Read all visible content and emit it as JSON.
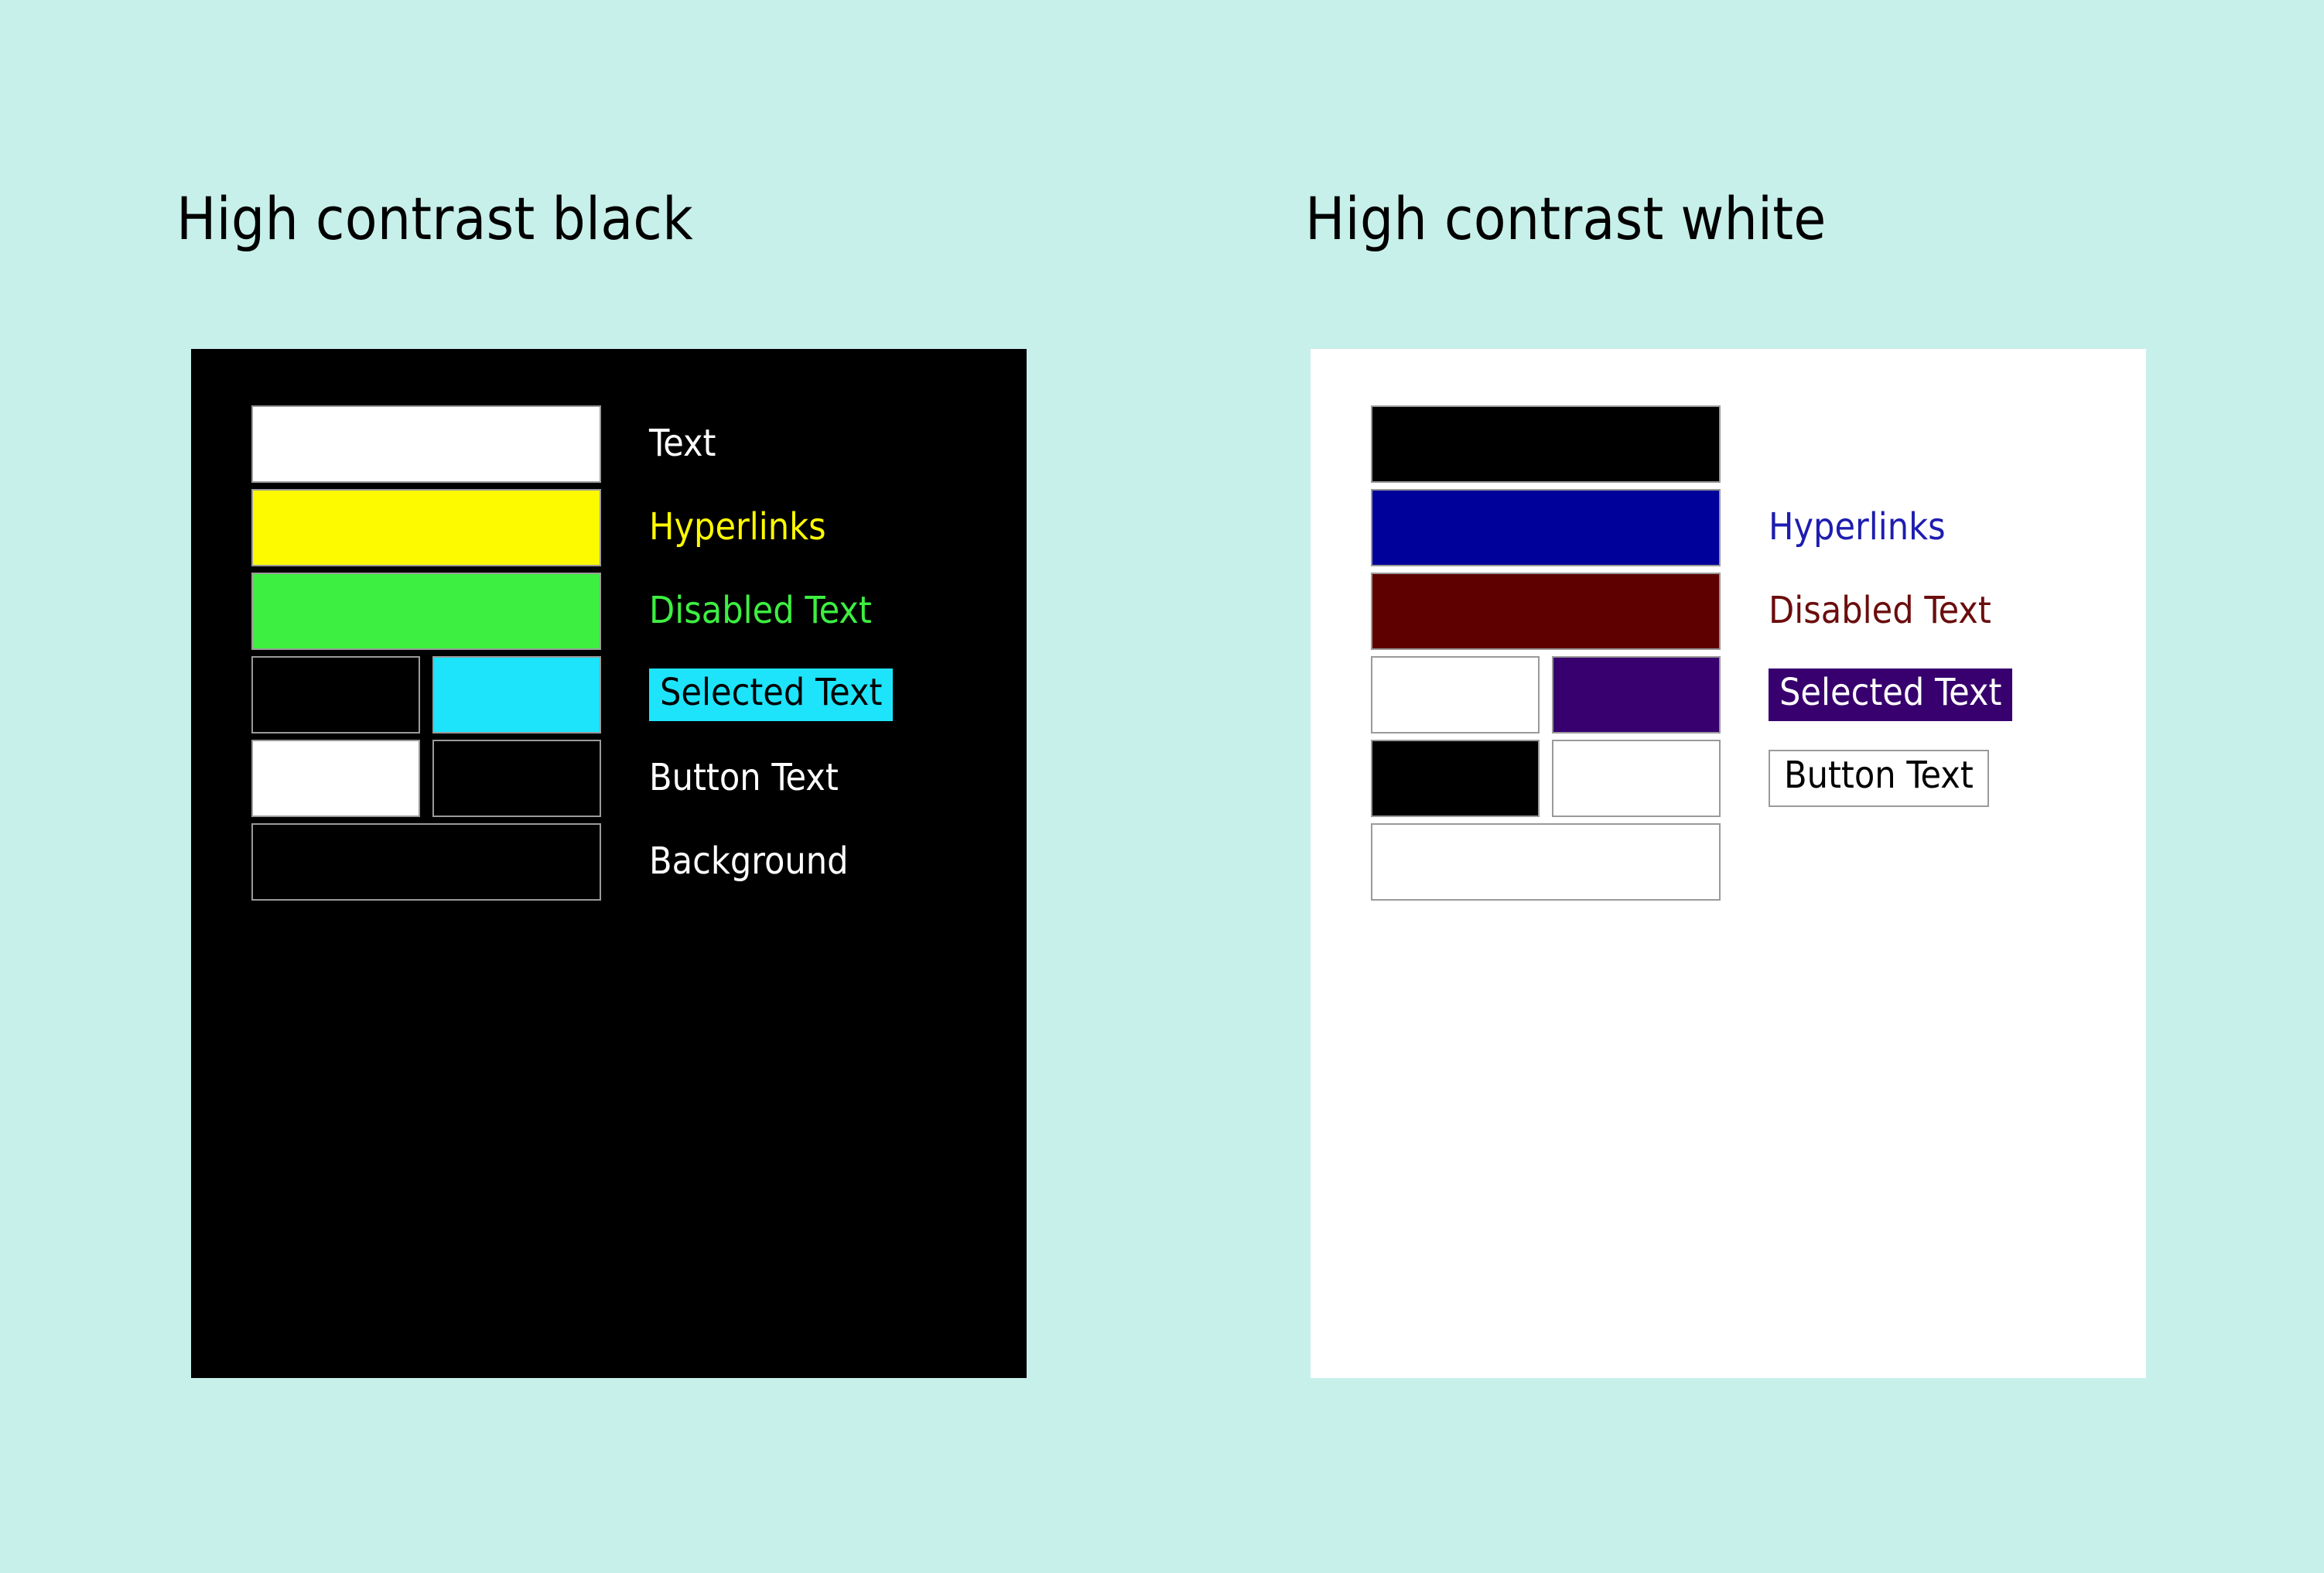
{
  "page": {
    "background_color": "#c8f0ea"
  },
  "themes": [
    {
      "id": "high-contrast-black",
      "title": "High contrast black",
      "panel_background": "#000000",
      "swatch_border_color": "#9a9a9a",
      "rows": [
        {
          "name": "text",
          "swatches": [
            {
              "color": "#ffffff"
            }
          ],
          "label": {
            "text": "Text",
            "color": "#ffffff",
            "background": "transparent",
            "style": "plain"
          }
        },
        {
          "name": "hyperlinks",
          "swatches": [
            {
              "color": "#fdfa00"
            }
          ],
          "label": {
            "text": "Hyperlinks",
            "color": "#fdfa00",
            "background": "transparent",
            "style": "plain"
          }
        },
        {
          "name": "disabled-text",
          "swatches": [
            {
              "color": "#3def41"
            }
          ],
          "label": {
            "text": "Disabled Text",
            "color": "#3def41",
            "background": "transparent",
            "style": "plain"
          }
        },
        {
          "name": "selected-text",
          "swatches": [
            {
              "color": "#000000"
            },
            {
              "color": "#1de4fa"
            }
          ],
          "label": {
            "text": "Selected Text",
            "color": "#000000",
            "background": "#1de4fa",
            "style": "chip"
          }
        },
        {
          "name": "button-text",
          "swatches": [
            {
              "color": "#ffffff"
            },
            {
              "color": "#000000"
            }
          ],
          "label": {
            "text": "Button Text",
            "color": "#ffffff",
            "background": "transparent",
            "style": "plain"
          }
        },
        {
          "name": "background",
          "swatches": [
            {
              "color": "#000000"
            }
          ],
          "label": {
            "text": "Background",
            "color": "#ffffff",
            "background": "transparent",
            "style": "plain"
          }
        }
      ]
    },
    {
      "id": "high-contrast-white",
      "title": "High contrast white",
      "panel_background": "#ffffff",
      "swatch_border_color": "#9a9a9a",
      "rows": [
        {
          "name": "text",
          "swatches": [
            {
              "color": "#000000"
            }
          ],
          "label": {
            "text": "",
            "color": "#000000",
            "background": "transparent",
            "style": "empty"
          }
        },
        {
          "name": "hyperlinks",
          "swatches": [
            {
              "color": "#00009b"
            }
          ],
          "label": {
            "text": "Hyperlinks",
            "color": "#1d1db0",
            "background": "transparent",
            "style": "plain"
          }
        },
        {
          "name": "disabled-text",
          "swatches": [
            {
              "color": "#5e0000"
            }
          ],
          "label": {
            "text": "Disabled Text",
            "color": "#6b0d0d",
            "background": "transparent",
            "style": "plain"
          }
        },
        {
          "name": "selected-text",
          "swatches": [
            {
              "color": "#ffffff"
            },
            {
              "color": "#37006e"
            }
          ],
          "label": {
            "text": "Selected Text",
            "color": "#ffffff",
            "background": "#37006e",
            "style": "chip"
          }
        },
        {
          "name": "button-text",
          "swatches": [
            {
              "color": "#000000"
            },
            {
              "color": "#ffffff"
            }
          ],
          "label": {
            "text": "Button Text",
            "color": "#000000",
            "background": "#ffffff",
            "style": "button"
          }
        },
        {
          "name": "background",
          "swatches": [
            {
              "color": "#ffffff"
            }
          ],
          "label": {
            "text": "",
            "color": "#000000",
            "background": "transparent",
            "style": "empty"
          }
        }
      ]
    }
  ]
}
